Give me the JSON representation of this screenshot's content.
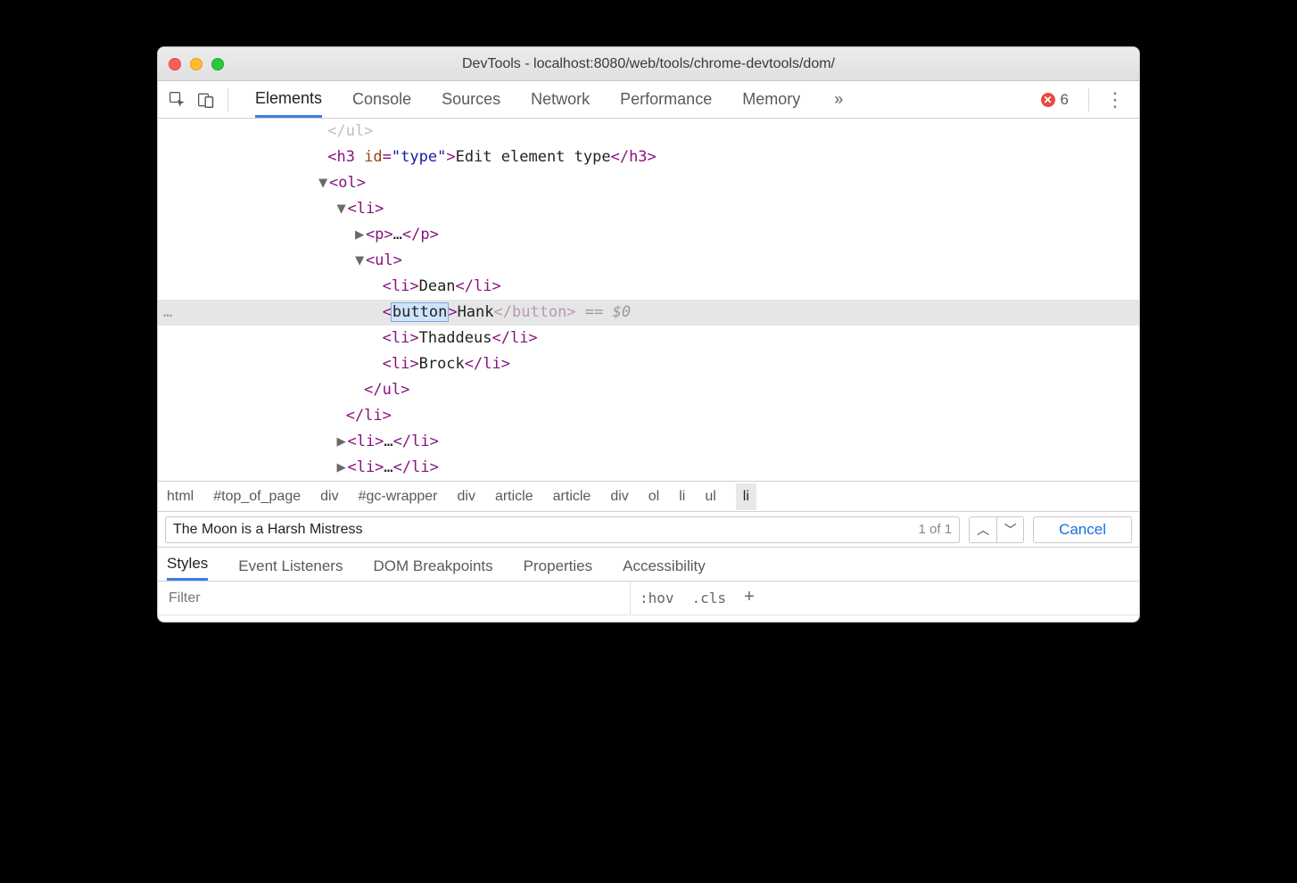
{
  "window": {
    "title": "DevTools - localhost:8080/web/tools/chrome-devtools/dom/"
  },
  "toolbar": {
    "tabs": [
      "Elements",
      "Console",
      "Sources",
      "Network",
      "Performance",
      "Memory"
    ],
    "overflow_glyph": "»",
    "error_count": "6"
  },
  "dom": {
    "line0_closing_ul": "</ul>",
    "h3": {
      "open": "<h3 ",
      "idn": "id",
      "idv": "\"type\"",
      "gt": ">",
      "text": "Edit element type",
      "close": "</h3>"
    },
    "ol_open": "<ol>",
    "li_open": "<li>",
    "p_collapsed": {
      "open": "<p>",
      "ell": "…",
      "close": "</p>"
    },
    "ul_open": "<ul>",
    "items": [
      {
        "open": "<li>",
        "text": "Dean",
        "close": "</li>"
      },
      {
        "open": "<li>",
        "text": "Thaddeus",
        "close": "</li>"
      },
      {
        "open": "<li>",
        "text": "Brock",
        "close": "</li>"
      }
    ],
    "selected": {
      "lt": "<",
      "edit": "button",
      "gt": ">",
      "text": "Hank",
      "close": "</button>",
      "marker": " == $0"
    },
    "ul_close": "</ul>",
    "li_close": "</li>",
    "li_collapsed": {
      "open": "<li>",
      "ell": "…",
      "close": "</li>"
    }
  },
  "breadcrumbs": [
    "html",
    "#top_of_page",
    "div",
    "#gc-wrapper",
    "div",
    "article",
    "article",
    "div",
    "ol",
    "li",
    "ul",
    "li"
  ],
  "search": {
    "value": "The Moon is a Harsh Mistress",
    "match": "1 of 1",
    "cancel": "Cancel"
  },
  "subtabs": [
    "Styles",
    "Event Listeners",
    "DOM Breakpoints",
    "Properties",
    "Accessibility"
  ],
  "stylesbar": {
    "filter_placeholder": "Filter",
    "hov": ":hov",
    "cls": ".cls",
    "plus": "+"
  }
}
